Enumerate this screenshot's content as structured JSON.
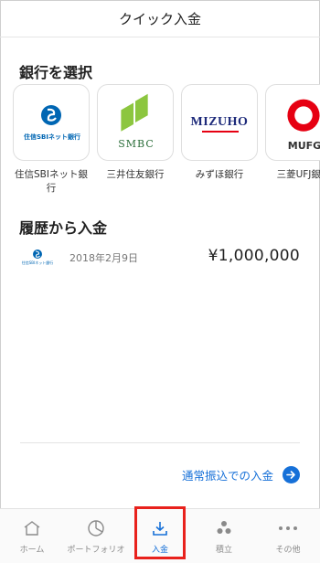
{
  "header": {
    "title": "クイック入金"
  },
  "bank_section": {
    "title": "銀行を選択",
    "banks": [
      {
        "label": "住信SBIネット銀行",
        "logo_text": "住信SBIネット銀行"
      },
      {
        "label": "三井住友銀行",
        "logo_text": "SMBC"
      },
      {
        "label": "みずほ銀行",
        "logo_text": "MIZUHO"
      },
      {
        "label": "三菱UFJ銀行",
        "logo_text": "MUFG"
      }
    ]
  },
  "history_section": {
    "title": "履歴から入金",
    "items": [
      {
        "bank_logo_text": "住信SBIネット銀行",
        "date": "2018年2月9日",
        "amount": "¥1,000,000"
      }
    ]
  },
  "transfer_link": {
    "label": "通常振込での入金"
  },
  "tabbar": {
    "items": [
      {
        "label": "ホーム",
        "icon": "home-icon"
      },
      {
        "label": "ポートフォリオ",
        "icon": "portfolio-icon"
      },
      {
        "label": "入金",
        "icon": "deposit-icon"
      },
      {
        "label": "積立",
        "icon": "savings-icon"
      },
      {
        "label": "その他",
        "icon": "more-icon"
      }
    ]
  },
  "colors": {
    "accent": "#1670d8",
    "highlight_box": "#e8211c",
    "smbc_green": "#8cc63f",
    "mizuho_blue": "#1d2a7a",
    "mufg_red": "#e60012",
    "sbi_blue": "#0066b3"
  }
}
